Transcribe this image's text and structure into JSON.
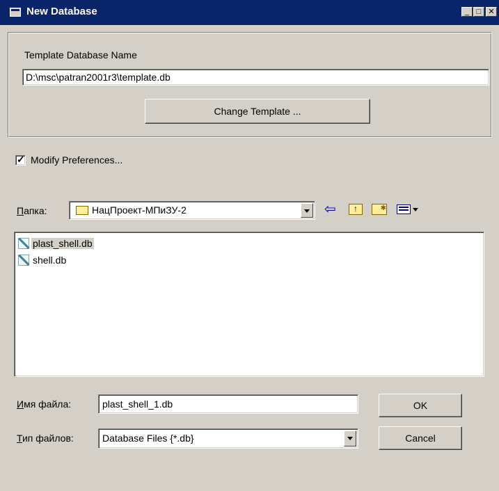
{
  "window": {
    "title": "New Database",
    "controls": {
      "minimize": "_",
      "maximize": "□",
      "close": "✕"
    }
  },
  "template": {
    "group_label": "Template Database Name",
    "path_value": "D:\\msc\\patran2001r3\\template.db",
    "change_button": "Change Template ..."
  },
  "modify_preferences": {
    "label": "Modify Preferences...",
    "checked": true
  },
  "file_dialog": {
    "folder_label_underlined": "П",
    "folder_label_rest": "апка:",
    "folder_value": "НацПроект-МПиЗУ-2",
    "files": [
      {
        "name": "plast_shell.db",
        "selected": true
      },
      {
        "name": "shell.db",
        "selected": false
      }
    ],
    "filename_label_underlined": "И",
    "filename_label_rest": "мя файла:",
    "filename_value": "plast_shell_1.db",
    "filetype_label_underlined": "Т",
    "filetype_label_rest": "ип файлов:",
    "filetype_value": "Database Files {*.db}",
    "ok_button": "OK",
    "cancel_button": "Cancel"
  }
}
